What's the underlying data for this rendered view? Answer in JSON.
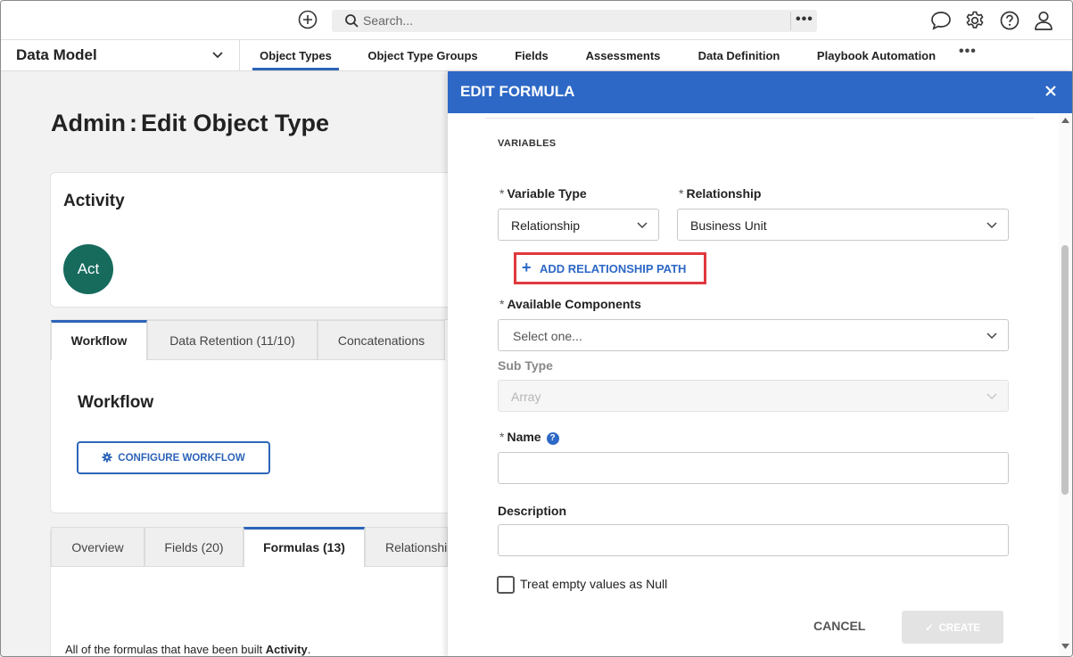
{
  "topbar": {
    "search_placeholder": "Search...",
    "search_more": "•••"
  },
  "navbar": {
    "section": "Data Model",
    "tabs": [
      "Object Types",
      "Object Type Groups",
      "Fields",
      "Assessments",
      "Data Definition",
      "Playbook Automation"
    ],
    "more": "•••"
  },
  "page": {
    "title": "Admin : Edit Object Type",
    "title_part1": "Admin",
    "title_part2": "Edit Object Type",
    "activity_title": "Activity",
    "avatar_text": "Act",
    "upper_tabs": [
      "Workflow",
      "Data Retention (11/10)",
      "Concatenations"
    ],
    "workflow_title": "Workflow",
    "configure_button": "CONFIGURE WORKFLOW",
    "lower_tabs": [
      "Overview",
      "Fields (20)",
      "Formulas (13)",
      "Relationshi"
    ],
    "formula_note_prefix": "All of the formulas that have been built ",
    "formula_note_bold": "Activity",
    "formula_note_suffix": "."
  },
  "panel": {
    "title": "EDIT FORMULA",
    "section_label": "VARIABLES",
    "variable_type_label": "Variable Type",
    "variable_type_value": "Relationship",
    "relationship_label": "Relationship",
    "relationship_value": "Business Unit",
    "add_relationship_path": "ADD RELATIONSHIP PATH",
    "available_components_label": "Available Components",
    "available_components_placeholder": "Select one...",
    "sub_type_label": "Sub Type",
    "sub_type_value": "Array",
    "name_label": "Name",
    "name_value": "",
    "description_label": "Description",
    "description_value": "",
    "treat_empty_label": "Treat empty values as Null",
    "cancel_label": "CANCEL",
    "create_label": "CREATE",
    "required_mark": "*",
    "help_mark": "?"
  },
  "colors": {
    "primary": "#2d68c6",
    "highlight_box": "#e0383e",
    "avatar": "#166b5d"
  }
}
